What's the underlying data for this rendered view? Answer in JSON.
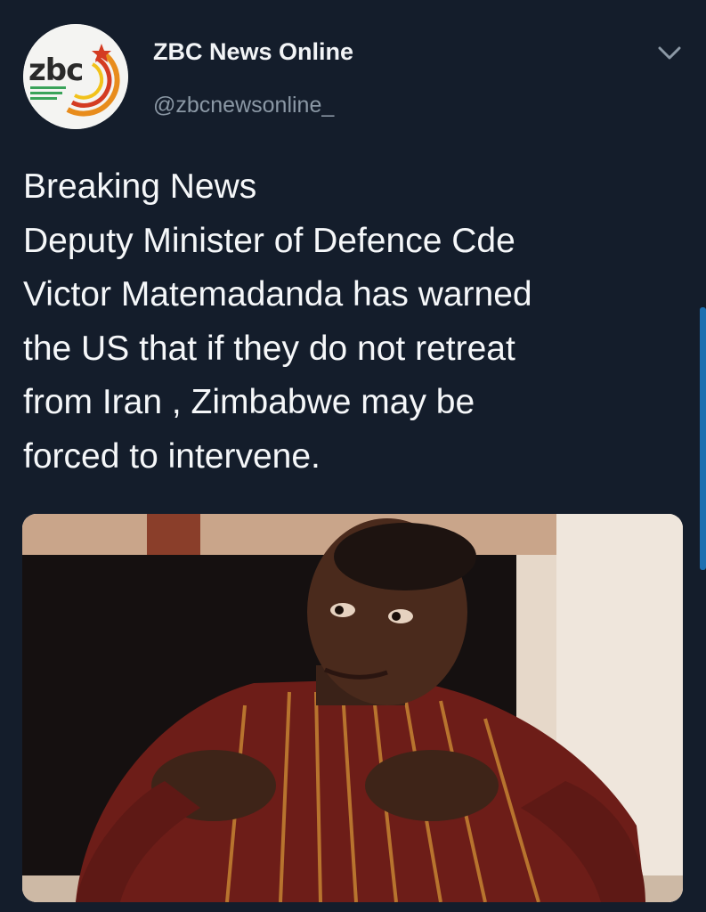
{
  "tweet": {
    "display_name": "ZBC News Online",
    "handle": "@zbcnewsonline_",
    "avatar_logo_text": "zbc",
    "text_lines": [
      "Breaking News",
      "Deputy Minister of Defence Cde",
      "Victor Matemadanda has warned",
      "the US that if they do not retreat",
      "from Iran , Zimbabwe may be",
      "forced to intervene."
    ],
    "menu_icon": "chevron-down-icon"
  },
  "colors": {
    "background": "#141d2b",
    "accent": "#1d6fb0",
    "handle": "#8b98a5"
  }
}
